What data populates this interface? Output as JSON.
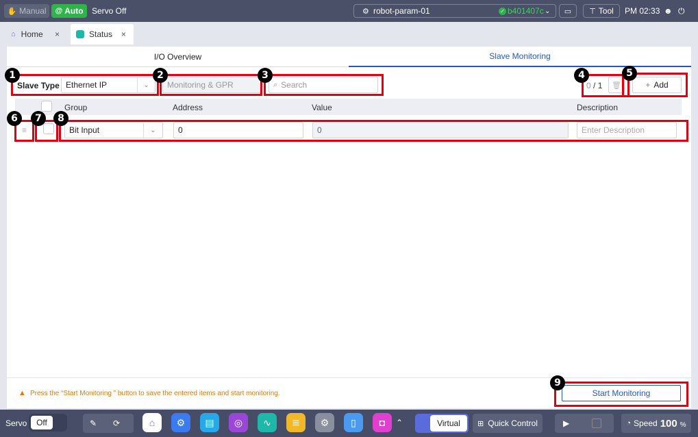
{
  "topbar": {
    "manual_label": "Manual",
    "auto_label": "Auto",
    "servo_label": "Servo Off",
    "robot_name": "robot-param-01",
    "commit_hash": "b401407c",
    "tool_label": "Tool",
    "time": "PM 02:33"
  },
  "tabs": [
    {
      "label": "Home"
    },
    {
      "label": "Status"
    }
  ],
  "subtabs": {
    "io_overview": "I/O Overview",
    "slave_monitoring": "Slave Monitoring"
  },
  "toolbar": {
    "slave_type_label": "Slave Type",
    "slave_type_value": "Ethernet IP",
    "mode_placeholder": "Monitoring & GPR",
    "search_placeholder": "Search",
    "count_selected": "0",
    "count_total": "/ 1",
    "add_label": "Add"
  },
  "table": {
    "columns": [
      "Group",
      "Address",
      "Value",
      "Description"
    ],
    "rows": [
      {
        "group": "Bit Input",
        "address": "0",
        "value": "0",
        "description_placeholder": "Enter Description"
      }
    ]
  },
  "footer": {
    "notice": "Press the “Start Monitoring ” button to save the entered items and start monitoring.",
    "start_label": "Start Monitoring"
  },
  "markers": [
    "1",
    "2",
    "3",
    "4",
    "5",
    "6",
    "7",
    "8",
    "9"
  ],
  "dock": {
    "servo_label": "Servo",
    "servo_state": "Off",
    "virtual_label": "Virtual",
    "quick_control_label": "Quick Control",
    "speed_label": "Speed",
    "speed_value": "100",
    "speed_unit": "%"
  },
  "colors": {
    "accent": "#2459b8",
    "auto_green": "#2fb34a",
    "annotation_red": "#e00010",
    "warning_orange": "#e07a00"
  }
}
